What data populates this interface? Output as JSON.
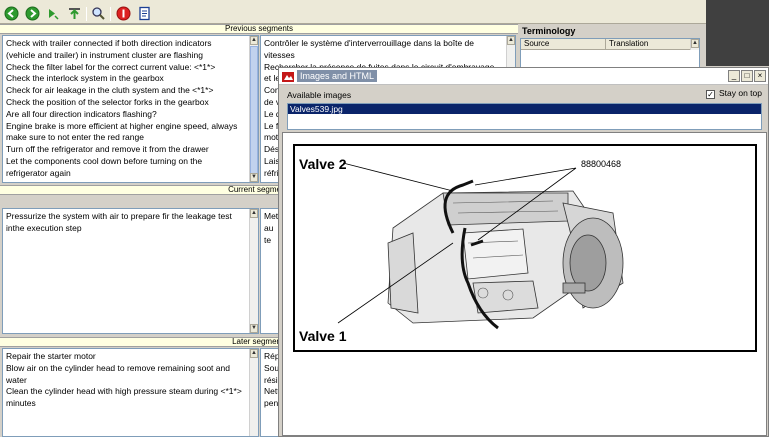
{
  "app": {
    "toolbar_buttons": [
      {
        "name": "go-back-icon",
        "icon": "green-circle-arrow-left"
      },
      {
        "name": "go-forward-icon",
        "icon": "green-circle-arrow-right"
      },
      {
        "name": "next-segment-icon",
        "icon": "green-arrow"
      },
      {
        "name": "upload-icon",
        "icon": "tray-arrow-up"
      },
      {
        "name": "search-icon",
        "icon": "magnifier"
      },
      {
        "name": "stop-icon",
        "icon": "red-circle"
      },
      {
        "name": "document-icon",
        "icon": "blue-page"
      }
    ],
    "colors": {
      "accent": "#0a246a",
      "header": "#ffffe1",
      "selection": "#0a246a"
    }
  },
  "previous": {
    "header": "Previous segments",
    "source_lines": [
      "Check with trailer connected if both direction indicators",
      "(vehicle and trailer) in instrument cluster are flashing",
      "Check the filter label for the correct current value: <*1*>",
      "Check the interlock system in the gearbox",
      "Check for air leakage in the cluth system and the <*1*>",
      "Check the position of the selector forks in the gearbox",
      "Are all four direction indicators flashing?",
      "Engine brake is more efficient at higher engine speed, always",
      "make sure to not enter the red range",
      "Turn off the refrigerator and remove it from the drawer",
      "Let the components cool down before turning on the",
      "refrigerator again"
    ],
    "target_lines": [
      "Contrôler le système d'interverrouillage dans la boîte de",
      "vitesses",
      "Rechercher la présence de fuites dans le circuit d'embrayage",
      "et le",
      "Con",
      "de v",
      "Le q",
      "Le fr",
      "mote",
      "Dése",
      "Lais",
      "réfrig"
    ]
  },
  "current": {
    "header": "Current segme",
    "source_lines": [
      "Pressurize the system with air to prepare fir the leakage test",
      "inthe execution step"
    ],
    "target_lines": [
      "Mett",
      "au te"
    ]
  },
  "later": {
    "header": "Later segmen",
    "source_lines": [
      "Repair the starter motor",
      "Blow air on the cylinder head to remove remaining soot and",
      "water",
      "Clean the cylinder head with high pressure steam during <*1*>",
      "minutes"
    ],
    "target_lines": [
      "Répa",
      "Souf",
      "résid",
      "Nett",
      "penc"
    ]
  },
  "terminology": {
    "title": "Terminology",
    "columns": [
      "Source",
      "Translation"
    ]
  },
  "images_dialog": {
    "title": "Images and HTML",
    "available_label": "Available images",
    "stay_on_top_label": "Stay on top",
    "stay_on_top_checked": true,
    "check_mark": "✓",
    "images": [
      "Valves539.jpg"
    ],
    "selected_index": 0,
    "window_buttons": [
      "_",
      "□",
      "×"
    ],
    "diagram": {
      "label_valve2": "Valve 2",
      "label_valve1": "Valve 1",
      "part_number": "88800468"
    }
  },
  "scroll": {
    "up": "▲",
    "down": "▼"
  }
}
